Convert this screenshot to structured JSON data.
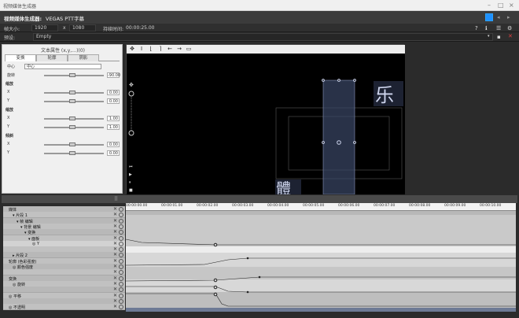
{
  "window": {
    "title": "视频媒体生成器"
  },
  "header": {
    "app_name": "视频媒体生成器:",
    "subtitle": "VEGAS PTT字幕"
  },
  "sizebar": {
    "frame_label": "帧大小:",
    "width": "1920",
    "x_label": "x",
    "height": "1080",
    "duration_label": "持续时间:",
    "duration": "00:00:25.00"
  },
  "presetbar": {
    "preset_label": "预设:",
    "preset_value": "Empty"
  },
  "left_panel": {
    "title": "文本属性 (x,y,…)(0)",
    "tabs": [
      "变换",
      "轮廓",
      "阴影"
    ],
    "rows": [
      {
        "key": "中心",
        "kind": "dropdown",
        "value": "中心"
      },
      {
        "key": "旋转",
        "kind": "slider",
        "value": "-90.00"
      },
      {
        "key": "缩放",
        "kind": "section"
      },
      {
        "key": "X",
        "kind": "slider",
        "value": "0.00"
      },
      {
        "key": "Y",
        "kind": "slider",
        "value": "0.00"
      },
      {
        "key": "缩放",
        "kind": "section"
      },
      {
        "key": "X",
        "kind": "slider",
        "value": "1.00"
      },
      {
        "key": "Y",
        "kind": "slider",
        "value": "1.00"
      },
      {
        "key": "倾斜",
        "kind": "section"
      },
      {
        "key": "X",
        "kind": "slider",
        "value": "0.00"
      },
      {
        "key": "Y",
        "kind": "slider",
        "value": "0.00"
      }
    ]
  },
  "timeline": {
    "rows": [
      {
        "label": "媒体",
        "indent": 1
      },
      {
        "label": "▾ 片段 1",
        "indent": 2
      },
      {
        "label": "▾ 帧 编辑",
        "indent": 3
      },
      {
        "label": "▾ 背景 编辑",
        "indent": 4
      },
      {
        "label": "▾ 变换",
        "indent": 5
      },
      {
        "label": "▾ 面板",
        "indent": 6
      },
      {
        "label": "◎ Y",
        "indent": 7
      },
      {
        "label": "",
        "indent": 1
      },
      {
        "label": "▸ 片段 2",
        "indent": 2
      },
      {
        "label": "轮廓 (色彩强度)",
        "indent": 1
      },
      {
        "label": "◎ 颜色强度",
        "indent": 2
      },
      {
        "label": "",
        "indent": 1
      },
      {
        "label": "变换",
        "indent": 1
      },
      {
        "label": "◎ 旋转",
        "indent": 2
      },
      {
        "label": "",
        "indent": 1
      },
      {
        "label": "◎ 平移",
        "indent": 1
      },
      {
        "label": "",
        "indent": 1
      },
      {
        "label": "◎ 不透明",
        "indent": 1
      }
    ],
    "ruler_labels": [
      "00:00:00.00",
      "00:00:01.00",
      "00:00:02.00",
      "00:00:03.00",
      "00:00:04.00",
      "00:00:05.00",
      "00:00:06.00",
      "00:00:07.00",
      "00:00:08.00",
      "00:00:09.00",
      "00:00:10.00"
    ]
  },
  "colors": {
    "accent": "#1e90ff",
    "viewer_bg": "#000000",
    "selection": "#5a6a90"
  }
}
